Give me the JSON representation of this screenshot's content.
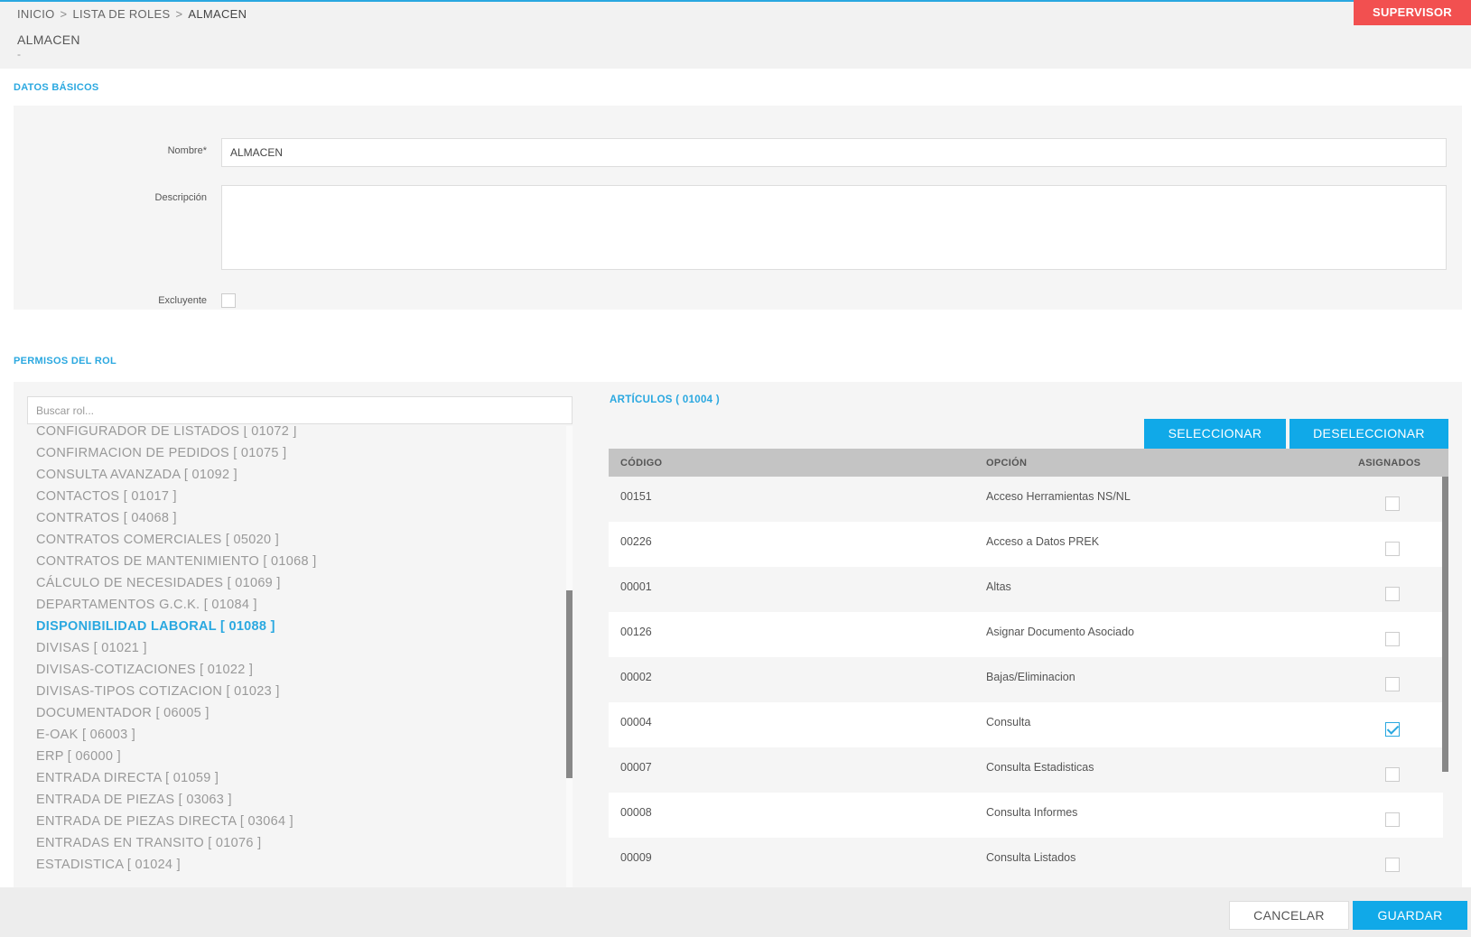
{
  "breadcrumb": {
    "items": [
      "INICIO",
      "LISTA DE ROLES",
      "ALMACEN"
    ],
    "separator": ">"
  },
  "user_role": "SUPERVISOR",
  "page": {
    "title": "ALMACEN",
    "subtitle": "-"
  },
  "basic_section": {
    "title": "DATOS BÁSICOS",
    "name_label": "Nombre*",
    "name_value": "ALMACEN",
    "description_label": "Descripción",
    "description_value": "",
    "exclusive_label": "Excluyente",
    "exclusive_checked": false
  },
  "permissions_section": {
    "title": "PERMISOS DEL ROL",
    "search_placeholder": "Buscar rol...",
    "roles": [
      {
        "label": "CONFIGURADOR DE LISTADOS [ 01072 ]",
        "active": false
      },
      {
        "label": "CONFIRMACION DE PEDIDOS [ 01075 ]",
        "active": false
      },
      {
        "label": "CONSULTA AVANZADA [ 01092 ]",
        "active": false
      },
      {
        "label": "CONTACTOS [ 01017 ]",
        "active": false
      },
      {
        "label": "CONTRATOS [ 04068 ]",
        "active": false
      },
      {
        "label": "CONTRATOS COMERCIALES [ 05020 ]",
        "active": false
      },
      {
        "label": "CONTRATOS DE MANTENIMIENTO [ 01068 ]",
        "active": false
      },
      {
        "label": "CÁLCULO DE NECESIDADES [ 01069 ]",
        "active": false
      },
      {
        "label": "DEPARTAMENTOS G.C.K. [ 01084 ]",
        "active": false
      },
      {
        "label": "DISPONIBILIDAD LABORAL [ 01088 ]",
        "active": true
      },
      {
        "label": "DIVISAS [ 01021 ]",
        "active": false
      },
      {
        "label": "DIVISAS-COTIZACIONES [ 01022 ]",
        "active": false
      },
      {
        "label": "DIVISAS-TIPOS COTIZACION [ 01023 ]",
        "active": false
      },
      {
        "label": "DOCUMENTADOR [ 06005 ]",
        "active": false
      },
      {
        "label": "E-OAK [ 06003 ]",
        "active": false
      },
      {
        "label": "ERP [ 06000 ]",
        "active": false
      },
      {
        "label": "ENTRADA DIRECTA [ 01059 ]",
        "active": false
      },
      {
        "label": "ENTRADA DE PIEZAS [ 03063 ]",
        "active": false
      },
      {
        "label": "ENTRADA DE PIEZAS DIRECTA [ 03064 ]",
        "active": false
      },
      {
        "label": "ENTRADAS EN TRANSITO [ 01076 ]",
        "active": false
      },
      {
        "label": "ESTADISTICA [ 01024 ]",
        "active": false
      }
    ],
    "module_title": "ARTÍCULOS ( 01004 )",
    "select_button": "SELECCIONAR",
    "deselect_button": "DESELECCIONAR",
    "columns": [
      "CÓDIGO",
      "OPCIÓN",
      "ASIGNADOS"
    ],
    "rows": [
      {
        "code": "00151",
        "option": "Acceso Herramientas NS/NL",
        "assigned": false
      },
      {
        "code": "00226",
        "option": "Acceso a Datos PREK",
        "assigned": false
      },
      {
        "code": "00001",
        "option": "Altas",
        "assigned": false
      },
      {
        "code": "00126",
        "option": "Asignar Documento Asociado",
        "assigned": false
      },
      {
        "code": "00002",
        "option": "Bajas/Eliminacion",
        "assigned": false
      },
      {
        "code": "00004",
        "option": "Consulta",
        "assigned": true
      },
      {
        "code": "00007",
        "option": "Consulta Estadisticas",
        "assigned": false
      },
      {
        "code": "00008",
        "option": "Consulta Informes",
        "assigned": false
      },
      {
        "code": "00009",
        "option": "Consulta Listados",
        "assigned": false
      }
    ]
  },
  "footer": {
    "cancel_button": "CANCELAR",
    "save_button": "GUARDAR"
  },
  "colors": {
    "accent": "#2aa8e0",
    "button_blue": "#10a9e8",
    "role_badge": "#f25050"
  }
}
